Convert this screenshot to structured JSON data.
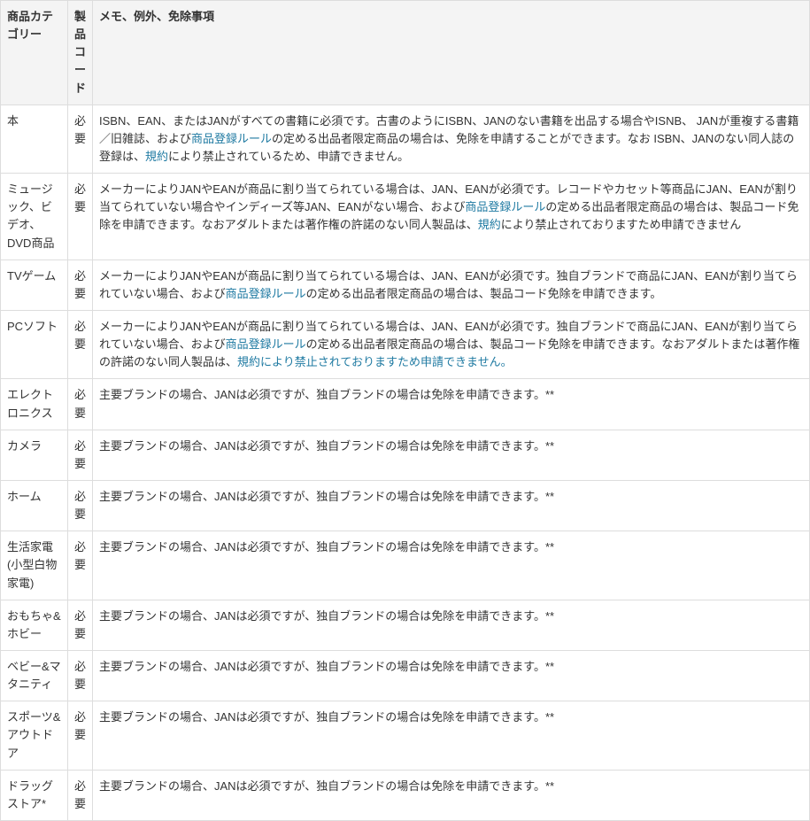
{
  "headers": {
    "category": "商品カテゴリー",
    "code": "製品コード",
    "notes": "メモ、例外、免除事項"
  },
  "rows": [
    {
      "category": "本",
      "code": "必要",
      "notes": [
        {
          "type": "text",
          "value": "ISBN、EAN、またはJANがすべての書籍に必須です。古書のようにISBN、JANのない書籍を出品する場合やISNB、 JANが重複する書籍／旧雑誌、および"
        },
        {
          "type": "link",
          "value": "商品登録ルール"
        },
        {
          "type": "text",
          "value": "の定める出品者限定商品の場合は、免除を申請することができます。なお ISBN、JANのない同人誌の登録は、"
        },
        {
          "type": "link",
          "value": "規約"
        },
        {
          "type": "text",
          "value": "により禁止されているため、申請できません。"
        }
      ]
    },
    {
      "category": "ミュージック、ビデオ、DVD商品",
      "code": "必要",
      "notes": [
        {
          "type": "text",
          "value": "メーカーによりJANやEANが商品に割り当てられている場合は、JAN、EANが必須です。レコードやカセット等商品にJAN、EANが割り当てられていない場合やインディーズ等JAN、EANがない場合、および"
        },
        {
          "type": "link",
          "value": "商品登録ルール"
        },
        {
          "type": "text",
          "value": "の定める出品者限定商品の場合は、製品コード免除を申請できます。なおアダルトまたは著作権の許諾のない同人製品は、"
        },
        {
          "type": "link",
          "value": "規約"
        },
        {
          "type": "text",
          "value": "により禁止されておりますため申請できません"
        }
      ]
    },
    {
      "category": "TVゲーム",
      "code": "必要",
      "notes": [
        {
          "type": "text",
          "value": "メーカーによりJANやEANが商品に割り当てられている場合は、JAN、EANが必須です。独自ブランドで商品にJAN、EANが割り当てられていない場合、および"
        },
        {
          "type": "link",
          "value": "商品登録ルール"
        },
        {
          "type": "text",
          "value": "の定める出品者限定商品の場合は、製品コード免除を申請できます。"
        }
      ]
    },
    {
      "category": "PCソフト",
      "code": "必要",
      "notes": [
        {
          "type": "text",
          "value": "メーカーによりJANやEANが商品に割り当てられている場合は、JAN、EANが必須です。独自ブランドで商品にJAN、EANが割り当てられていない場合、および"
        },
        {
          "type": "link",
          "value": "商品登録ルール"
        },
        {
          "type": "text",
          "value": "の定める出品者限定商品の場合は、製品コード免除を申請できます。なおアダルトまたは著作権の許諾のない同人製品は、"
        },
        {
          "type": "link",
          "value": "規約により禁止されておりますため申請できません。"
        }
      ]
    },
    {
      "category": "エレクトロニクス",
      "code": "必要",
      "notes": [
        {
          "type": "text",
          "value": "主要ブランドの場合、JANは必須ですが、独自ブランドの場合は免除を申請できます。**"
        }
      ]
    },
    {
      "category": "カメラ",
      "code": "必要",
      "notes": [
        {
          "type": "text",
          "value": "主要ブランドの場合、JANは必須ですが、独自ブランドの場合は免除を申請できます。**"
        }
      ]
    },
    {
      "category": "ホーム",
      "code": "必要",
      "notes": [
        {
          "type": "text",
          "value": "主要ブランドの場合、JANは必須ですが、独自ブランドの場合は免除を申請できます。**"
        }
      ]
    },
    {
      "category": "生活家電(小型白物家電)",
      "code": "必要",
      "notes": [
        {
          "type": "text",
          "value": "主要ブランドの場合、JANは必須ですが、独自ブランドの場合は免除を申請できます。**"
        }
      ]
    },
    {
      "category": "おもちゃ&ホビー",
      "code": "必要",
      "notes": [
        {
          "type": "text",
          "value": "主要ブランドの場合、JANは必須ですが、独自ブランドの場合は免除を申請できます。**"
        }
      ]
    },
    {
      "category": "ベビー&マタニティ",
      "code": "必要",
      "notes": [
        {
          "type": "text",
          "value": "主要ブランドの場合、JANは必須ですが、独自ブランドの場合は免除を申請できます。**"
        }
      ]
    },
    {
      "category": "スポーツ&アウトドア",
      "code": "必要",
      "notes": [
        {
          "type": "text",
          "value": "主要ブランドの場合、JANは必須ですが、独自ブランドの場合は免除を申請できます。**"
        }
      ]
    },
    {
      "category": "ドラッグストア*",
      "code": "必要",
      "notes": [
        {
          "type": "text",
          "value": "主要ブランドの場合、JANは必須ですが、独自ブランドの場合は免除を申請できます。**"
        }
      ]
    }
  ]
}
